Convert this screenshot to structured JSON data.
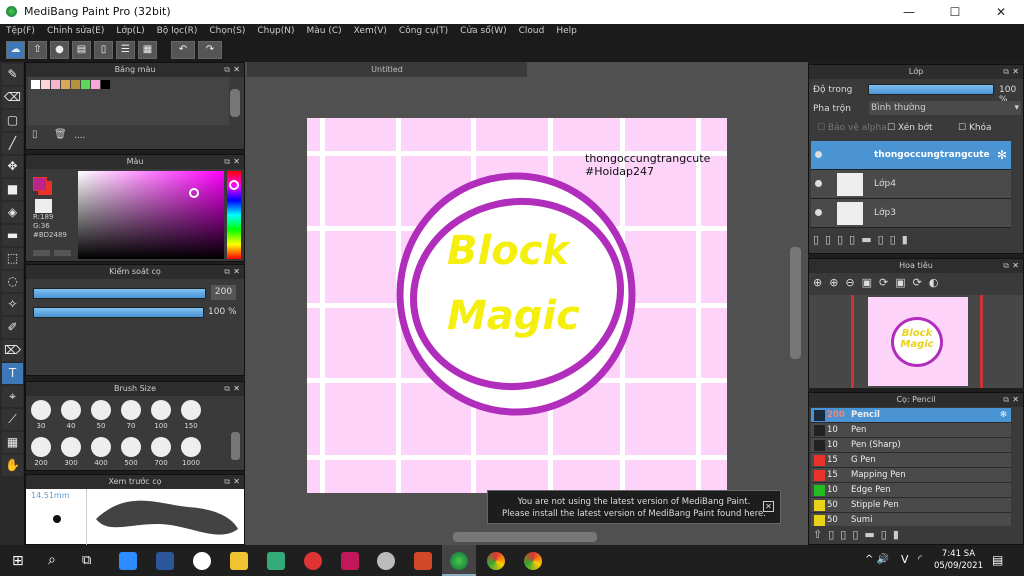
{
  "window": {
    "title": "MediBang Paint Pro (32bit)",
    "minimize": "—",
    "maximize": "☐",
    "close": "✕"
  },
  "menu": [
    "Tệp(F)",
    "Chỉnh sửa(E)",
    "Lớp(L)",
    "Bộ lọc(R)",
    "Chọn(S)",
    "Chụp(N)",
    "Màu (C)",
    "Xem(V)",
    "Công cụ(T)",
    "Cửa sổ(W)",
    "Cloud",
    "Help"
  ],
  "toolbar_icons": [
    "cloud-icon",
    "export-icon",
    "comment-icon",
    "comment-list-icon",
    "page-icon",
    "page-list-icon",
    "layout-icon",
    "undo-icon",
    "redo-icon"
  ],
  "left_tools": [
    "brush-icon",
    "eraser-icon",
    "rectangle-icon",
    "line-icon",
    "move-icon",
    "fill-rect-icon",
    "bucket-icon",
    "gradient-icon",
    "select-rect-icon",
    "lasso-icon",
    "magic-wand-icon",
    "select-pen-icon",
    "select-eraser-icon",
    "text-icon",
    "operation-icon",
    "eyedropper-icon",
    "divide-icon",
    "hand-icon"
  ],
  "palette": {
    "title": "Bảng màu",
    "colors": [
      "#ffffff",
      "#fbd5dc",
      "#f7b2cc",
      "#d9a75a",
      "#b8913e",
      "#5ed85a",
      "#f9a6d8",
      "#000000"
    ],
    "label": "...."
  },
  "color": {
    "title": "Màu",
    "r": "R:189",
    "g": "G:36",
    "hex": "#BD2489",
    "foreground": "#bd2489",
    "accent": "#e8322a"
  },
  "brush_control": {
    "title": "Kiểm soát cọ",
    "size": "200",
    "opacity": "100 %"
  },
  "brush_size": {
    "title": "Brush Size",
    "sizes": [
      "30",
      "40",
      "50",
      "70",
      "100",
      "150",
      "200",
      "300",
      "400",
      "500",
      "700",
      "1000"
    ]
  },
  "brush_preview": {
    "title": "Xem trước cọ",
    "size": "14.51mm"
  },
  "canvas": {
    "tab": "Untitled",
    "text_line1": "thongoccungtrangcute",
    "text_line2": "#Hoidap247",
    "title_line1": "Block",
    "title_line2": "Magic",
    "bg": "#fdd3fa",
    "circle": "#b12dbb",
    "text_color": "#f5ef10"
  },
  "notice": {
    "line1": "You are not using the latest version of MediBang Paint.",
    "line2": "Please install the latest version of MediBang Paint found here.",
    "close": "✕"
  },
  "layers": {
    "title": "Lớp",
    "opacity_label": "Độ trong",
    "opacity": "100 %",
    "opacity_value": 100,
    "blend_label": "Pha trộn",
    "blend": "Bình thường",
    "protect_alpha": "Bảo vệ alpha",
    "clip": "Xén bớt",
    "lock": "Khóa",
    "items": [
      {
        "name": "thongoccungtrangcute",
        "selected": true
      },
      {
        "name": "Lớp4"
      },
      {
        "name": "Lớp3"
      }
    ]
  },
  "navigator": {
    "title": "Hoa tiêu"
  },
  "brushes": {
    "title": "Cọ: Pencil",
    "items": [
      {
        "size": "200",
        "name": "Pencil",
        "color": "#1b2a3a"
      },
      {
        "size": "10",
        "name": "Pen",
        "color": "#222222"
      },
      {
        "size": "10",
        "name": "Pen (Sharp)",
        "color": "#222222"
      },
      {
        "size": "15",
        "name": "G Pen",
        "color": "#e8322a"
      },
      {
        "size": "15",
        "name": "Mapping Pen",
        "color": "#e8322a"
      },
      {
        "size": "10",
        "name": "Edge Pen",
        "color": "#22bb22"
      },
      {
        "size": "50",
        "name": "Stipple Pen",
        "color": "#e8d21a"
      },
      {
        "size": "50",
        "name": "Sumi",
        "color": "#e8d21a"
      }
    ]
  },
  "taskbar": {
    "time": "7:41 SA",
    "date": "05/09/2021",
    "lang": "V"
  }
}
